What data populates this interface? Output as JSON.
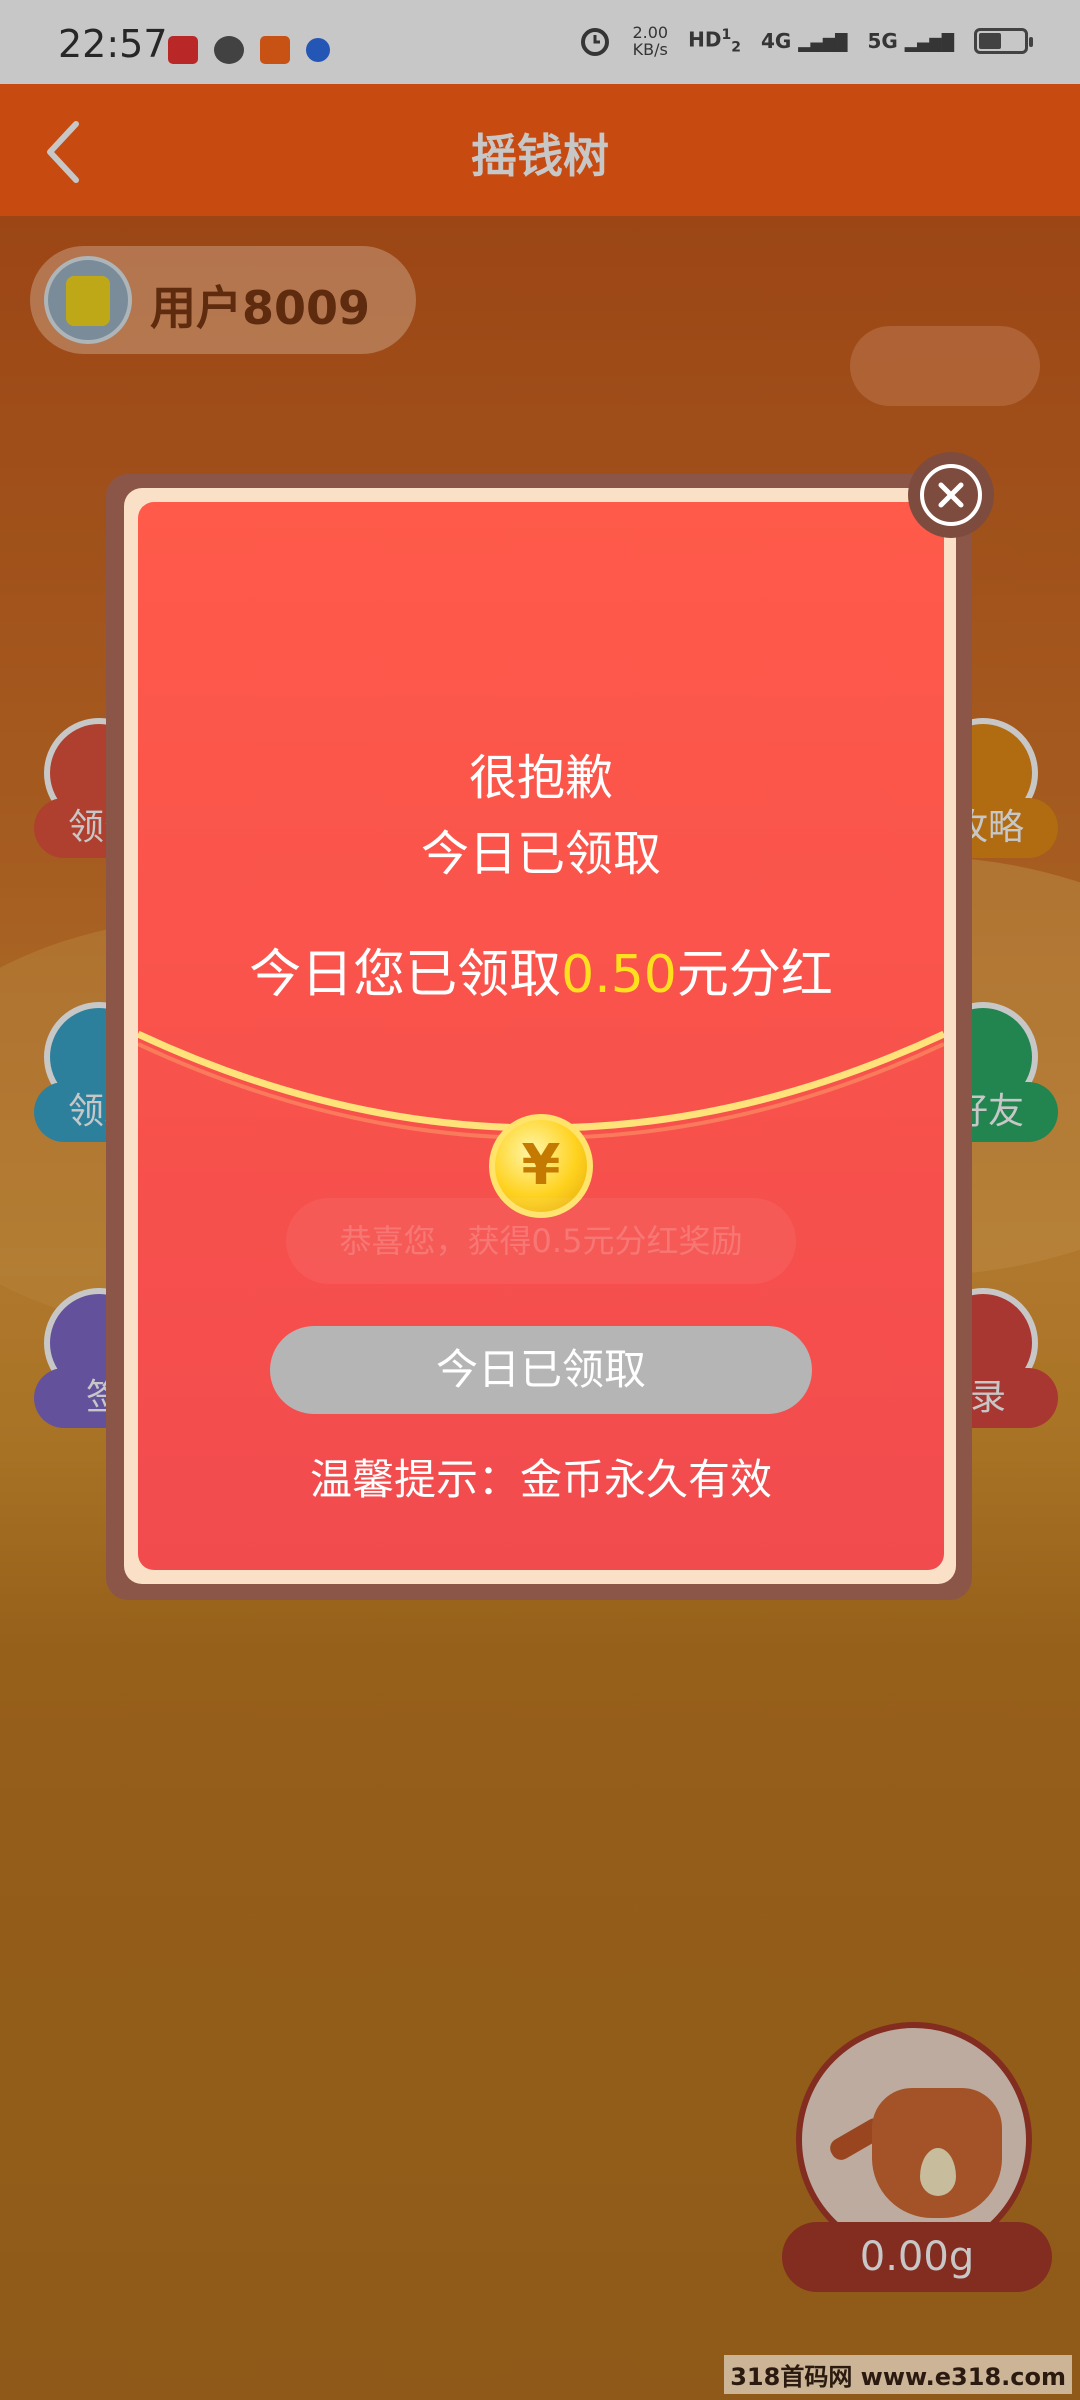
{
  "status_bar": {
    "time": "22:57",
    "app_icons": [
      "toutiao-icon",
      "app-icon",
      "kuaishou-icon",
      "baidu-icon"
    ],
    "alarm_icon": "alarm-icon",
    "net_speed_value": "2.00",
    "net_speed_unit": "KB/s",
    "hd": "HD",
    "sim_1": "1",
    "sim_2": "2",
    "network_1": "4G",
    "network_2": "5G"
  },
  "header": {
    "title": "摇钱树",
    "back_icon": "chevron-left-icon"
  },
  "user": {
    "name": "用户8009"
  },
  "side_buttons": {
    "left": [
      {
        "label": "领分",
        "color": "#e0523d"
      },
      {
        "label": "领水",
        "color": "#3aa5c8"
      },
      {
        "label": "签",
        "color": "#8168c8"
      }
    ],
    "right": [
      {
        "label": "攻略",
        "color": "#e38a16"
      },
      {
        "label": "好友",
        "color": "#2caa66"
      },
      {
        "label": "录",
        "color": "#d8463f"
      }
    ]
  },
  "kettle": {
    "value": "0.00g"
  },
  "modal": {
    "line1": "很抱歉",
    "line2": "今日已领取",
    "line3_prefix": "今日您已领取",
    "line3_amount": "0.50",
    "line3_suffix": "元分红",
    "coin_symbol": "¥",
    "faded_text": "恭喜您，获得0.5元分红奖励",
    "button_label": "今日已领取",
    "tip": "温馨提示：金币永久有效",
    "accent_color": "#ffe01e"
  },
  "watermark": "318首码网 www.e318.com"
}
